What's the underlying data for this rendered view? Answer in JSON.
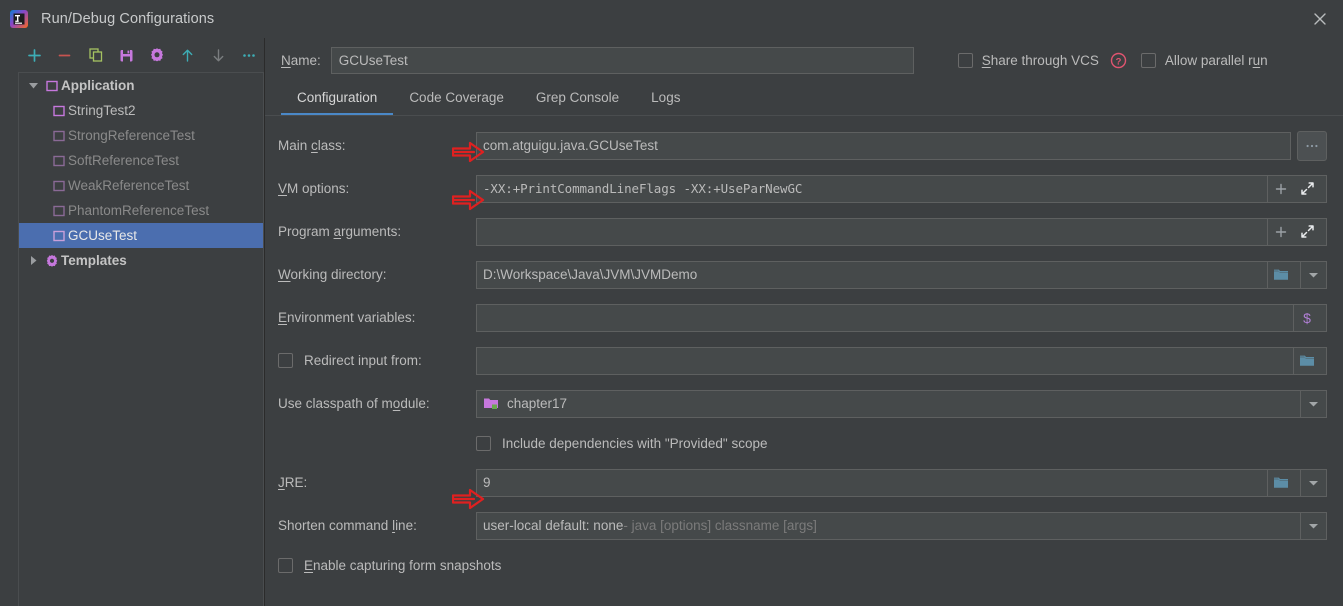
{
  "window": {
    "title": "Run/Debug Configurations",
    "logo_icon": "intellij-idea-logo",
    "close_icon": "close-icon"
  },
  "toolbar": {
    "buttons": [
      {
        "name": "add-configuration-button",
        "icon": "plus-icon",
        "color": "#3dadb5"
      },
      {
        "name": "remove-configuration-button",
        "icon": "minus-icon",
        "color": "#c75450"
      },
      {
        "name": "copy-configuration-button",
        "icon": "copy-icon",
        "color": "#a5c261"
      },
      {
        "name": "save-configuration-button",
        "icon": "save-floppy-icon",
        "color": "#c678dd"
      },
      {
        "name": "edit-templates-button",
        "icon": "gear-icon",
        "color": "#c678dd"
      },
      {
        "name": "move-up-button",
        "icon": "arrow-up-icon",
        "color": "#3dadb5"
      },
      {
        "name": "move-down-button",
        "icon": "arrow-down-icon",
        "color": "#777777"
      },
      {
        "name": "more-options-button",
        "icon": "ellipsis-icon",
        "color": "#3dadb5"
      }
    ]
  },
  "sidebar": {
    "nodes": [
      {
        "label": "Application",
        "type": "group",
        "icon": "application-folder-icon",
        "expanded": true,
        "dim": false,
        "selected": false
      },
      {
        "label": "StringTest2",
        "type": "item",
        "icon": "run-config-icon",
        "dim": false,
        "selected": false
      },
      {
        "label": "StrongReferenceTest",
        "type": "item",
        "icon": "run-config-icon",
        "dim": true,
        "selected": false
      },
      {
        "label": "SoftReferenceTest",
        "type": "item",
        "icon": "run-config-icon",
        "dim": true,
        "selected": false
      },
      {
        "label": "WeakReferenceTest",
        "type": "item",
        "icon": "run-config-icon",
        "dim": true,
        "selected": false
      },
      {
        "label": "PhantomReferenceTest",
        "type": "item",
        "icon": "run-config-icon",
        "dim": true,
        "selected": false
      },
      {
        "label": "GCUseTest",
        "type": "item",
        "icon": "run-config-icon",
        "dim": false,
        "selected": true
      },
      {
        "label": "Templates",
        "type": "group",
        "icon": "templates-gear-icon",
        "expanded": false,
        "dim": false,
        "selected": false
      }
    ]
  },
  "header": {
    "name_label": "Name:",
    "name_value": "GCUseTest",
    "share_vcs_label": "Share through VCS",
    "share_vcs_checked": false,
    "help_icon": "help-question-icon",
    "allow_parallel_label": "Allow parallel run",
    "allow_parallel_checked": false
  },
  "tabs": [
    {
      "label": "Configuration",
      "active": true
    },
    {
      "label": "Code Coverage",
      "active": false
    },
    {
      "label": "Grep Console",
      "active": false
    },
    {
      "label": "Logs",
      "active": false
    }
  ],
  "form": {
    "main_class": {
      "label": "Main class:",
      "value": "com.atguigu.java.GCUseTest",
      "browse_button": "…",
      "has_arrow": true
    },
    "vm_options": {
      "label": "VM options:",
      "value": "-XX:+PrintCommandLineFlags -XX:+UseParNewGC",
      "has_arrow": true,
      "icons": [
        "plus-icon",
        "expand-icon"
      ]
    },
    "program_arguments": {
      "label": "Program arguments:",
      "value": "",
      "icons": [
        "plus-icon",
        "expand-icon"
      ]
    },
    "working_directory": {
      "label": "Working directory:",
      "value": "D:\\Workspace\\Java\\JVM\\JVMDemo",
      "icons": [
        "folder-icon",
        "chevron-down-icon"
      ]
    },
    "environment_variables": {
      "label": "Environment variables:",
      "value": "",
      "icons": [
        "dollar-macro-icon"
      ]
    },
    "redirect_input": {
      "label": "Redirect input from:",
      "checked": false,
      "value": "",
      "icons": [
        "folder-icon"
      ]
    },
    "classpath_module": {
      "label": "Use classpath of module:",
      "value": "chapter17",
      "icon": "module-folder-icon",
      "icons": [
        "chevron-down-icon"
      ]
    },
    "include_provided": {
      "label": "Include dependencies with \"Provided\" scope",
      "checked": false
    },
    "jre": {
      "label": "JRE:",
      "value": "9",
      "has_arrow": true,
      "icons": [
        "folder-icon",
        "chevron-down-icon"
      ]
    },
    "shorten_command_line": {
      "label": "Shorten command line:",
      "value": "user-local default: none",
      "value_hint": " - java [options] classname [args]",
      "icons": [
        "chevron-down-icon"
      ]
    },
    "enable_capturing": {
      "label": "Enable capturing form snapshots",
      "checked": false
    }
  },
  "colors": {
    "background": "#3c3f41",
    "field_background": "#45494a",
    "selection": "#4b6eaf",
    "tab_accent": "#4a88c7",
    "annotation_arrow": "#e02020",
    "text": "#bbbbbb",
    "text_dim": "#8a8a8a"
  }
}
